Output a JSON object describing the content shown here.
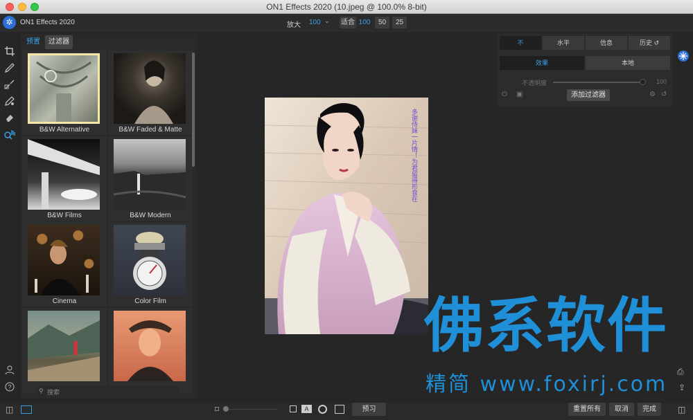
{
  "window": {
    "title": "ON1 Effects 2020 (10.jpeg @ 100.0% 8-bit)"
  },
  "app": {
    "name": "ON1 Effects 2020"
  },
  "zoom": {
    "label": "放大",
    "value": "100",
    "fit_label": "适合",
    "buttons": [
      "100",
      "50",
      "25"
    ]
  },
  "browser": {
    "tabs": {
      "presets": "预置",
      "filters": "过滤器"
    },
    "presets": [
      {
        "name": "B&W Alternative",
        "selected": true
      },
      {
        "name": "B&W Faded & Matte",
        "selected": false
      },
      {
        "name": "B&W Films",
        "selected": false
      },
      {
        "name": "B&W Modern",
        "selected": false
      },
      {
        "name": "Cinema",
        "selected": false
      },
      {
        "name": "Color Film",
        "selected": false
      },
      {
        "name": "",
        "selected": false
      },
      {
        "name": "",
        "selected": false
      }
    ],
    "search_placeholder": "搜索"
  },
  "right_panel": {
    "tabs": [
      "不",
      "水平",
      "信息",
      "历史"
    ],
    "sub_tabs": [
      "效果",
      "本地"
    ],
    "opacity_label": "不透明度",
    "opacity_value": "100",
    "add_filter": "添加过滤器"
  },
  "photo_text": "多谢侍妹一片情！为君留得形音在",
  "bottom": {
    "preview": "预习",
    "reset_all": "重置所有",
    "cancel": "取消",
    "done": "完成"
  },
  "watermark": {
    "main": "佛系软件",
    "sub": "精简 www.foxirj.com"
  },
  "colors": {
    "accent": "#3aa0e8",
    "watermark": "#1f8fd8"
  },
  "icons": [
    "crop-icon",
    "brush-icon",
    "gradient-icon",
    "retouch-icon",
    "eraser-icon",
    "zoom-hand-icon",
    "user-icon",
    "help-icon",
    "settings-gear-icon",
    "print-icon",
    "share-icon"
  ]
}
